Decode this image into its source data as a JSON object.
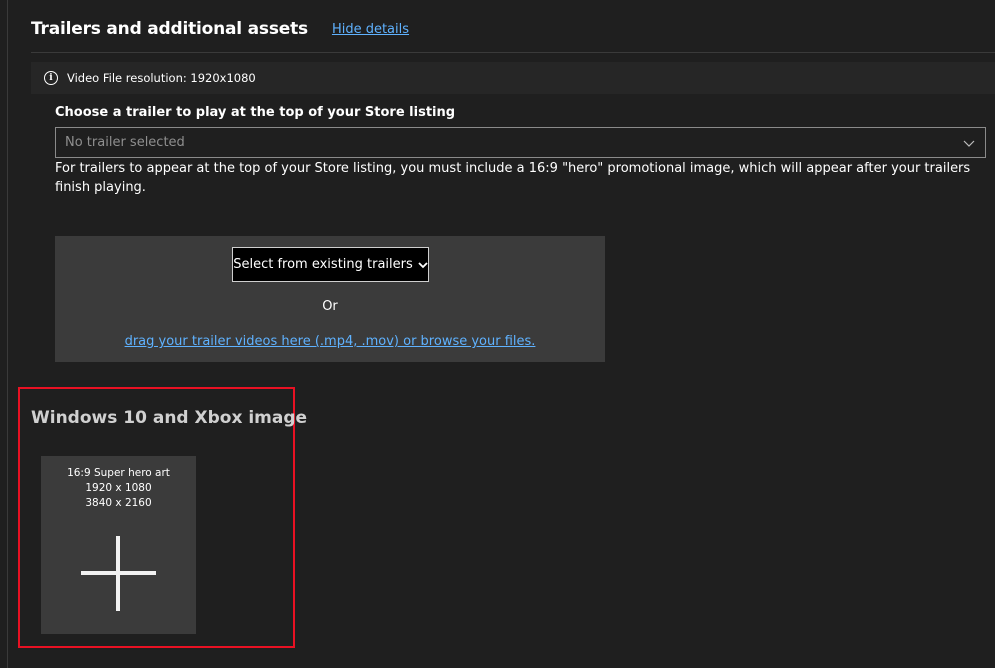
{
  "section": {
    "title": "Trailers and additional assets",
    "hide_details_link": "Hide details"
  },
  "info_bar": {
    "icon": "info-icon",
    "text": "Video File resolution: 1920x1080"
  },
  "trailer_chooser": {
    "label": "Choose a trailer to play at the top of your Store listing",
    "selected_value": "No trailer selected",
    "help_text": "For trailers to appear at the top of your Store listing, you must include a 16:9 \"hero\" promotional image, which will appear after your trailers finish playing."
  },
  "upload_zone": {
    "existing_trailers_label": "Select from existing trailers",
    "or_text": "Or",
    "drag_link": "drag your trailer videos here (.mp4, .mov) or browse your files."
  },
  "image_section": {
    "title": "Windows 10 and Xbox image",
    "tile": {
      "line1": "16:9 Super hero art",
      "line2": "1920 x 1080",
      "line3": "3840 x 2160",
      "icon": "plus-icon"
    }
  },
  "colors": {
    "background": "#1f1f1f",
    "panel": "#3b3b3b",
    "link": "#5fb2ff",
    "highlight": "#e81123"
  }
}
